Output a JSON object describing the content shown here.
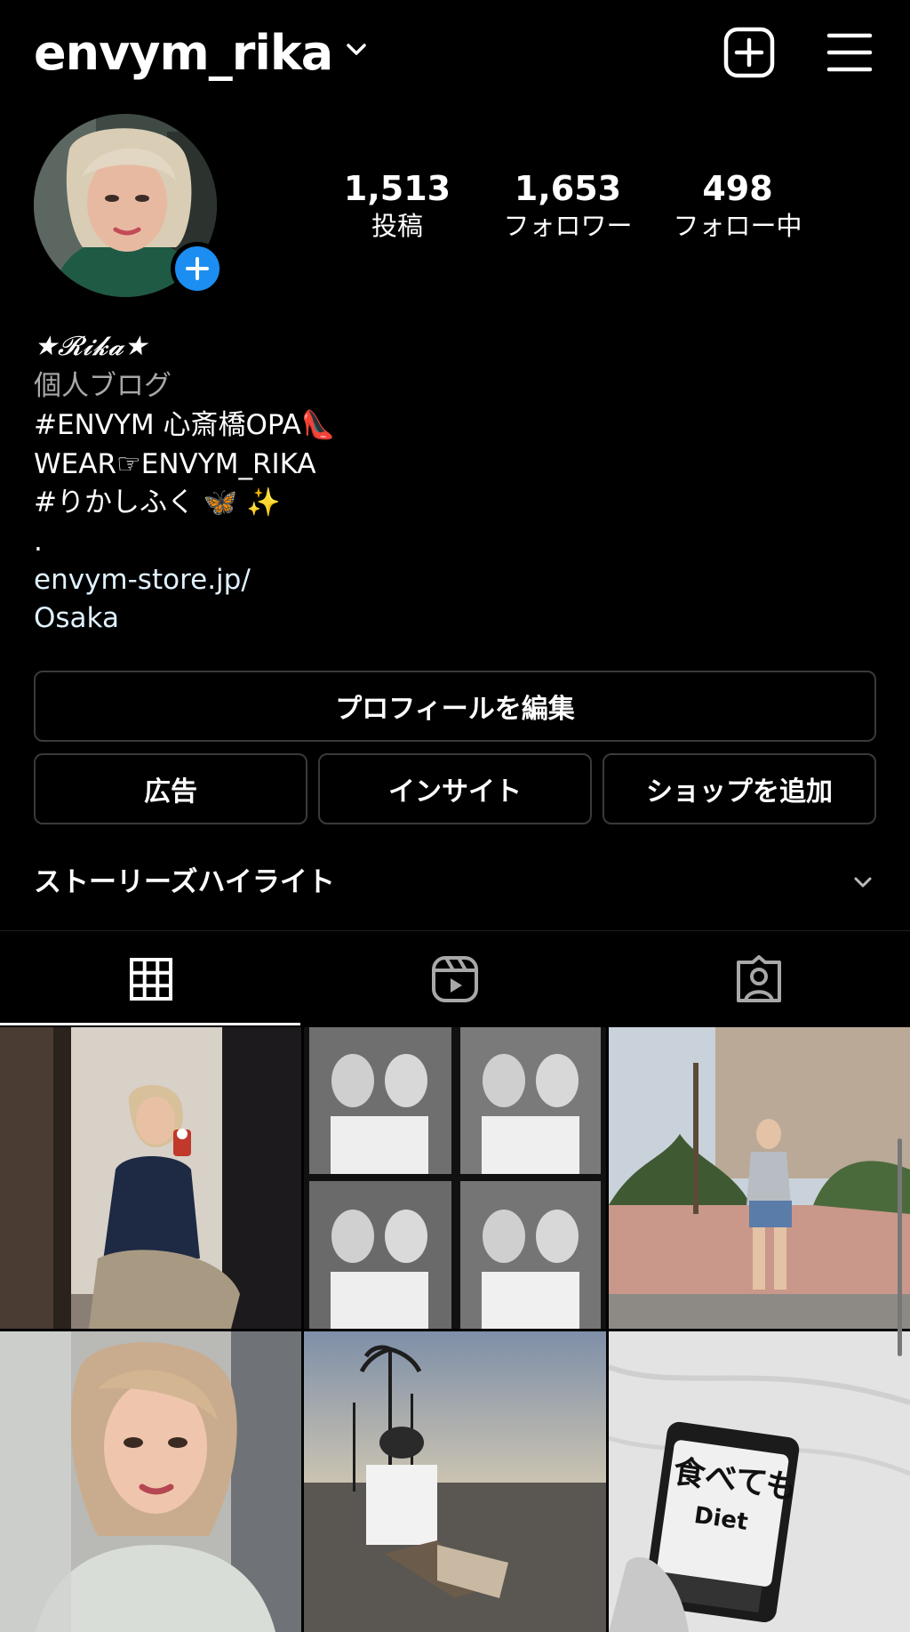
{
  "header": {
    "username": "envym_rika",
    "icons": {
      "switch_account": "chevron-down-icon",
      "create": "plus-square-icon",
      "menu": "hamburger-menu-icon"
    }
  },
  "profile": {
    "stats": [
      {
        "value": "1,513",
        "label": "投稿"
      },
      {
        "value": "1,653",
        "label": "フォロワー"
      },
      {
        "value": "498",
        "label": "フォロー中"
      }
    ],
    "bio": {
      "name": "★𝓡𝓲𝓴𝓪★",
      "category": "個人ブログ",
      "lines": [
        "#ENVYM 心斎橋OPA👠",
        "WEAR☞ENVYM_RIKA",
        "#りかしふく 🦋 ✨",
        "."
      ],
      "link": "envym-store.jp/",
      "location": "Osaka"
    }
  },
  "actions": {
    "edit_profile": "プロフィールを編集",
    "ads": "広告",
    "insights": "インサイト",
    "add_shop": "ショップを追加"
  },
  "highlights": {
    "label": "ストーリーズハイライト"
  },
  "tabs": [
    {
      "name": "grid",
      "icon": "grid-icon",
      "active": true
    },
    {
      "name": "reels",
      "icon": "reels-icon",
      "active": false
    },
    {
      "name": "tagged",
      "icon": "tagged-person-icon",
      "active": false
    }
  ],
  "grid_post_text": {
    "diet_pack_title": "食べても",
    "diet_pack_sub": "Diet"
  },
  "colors": {
    "accent_blue": "#1c8ef2",
    "link": "#e0f1ff",
    "background": "#000000"
  }
}
